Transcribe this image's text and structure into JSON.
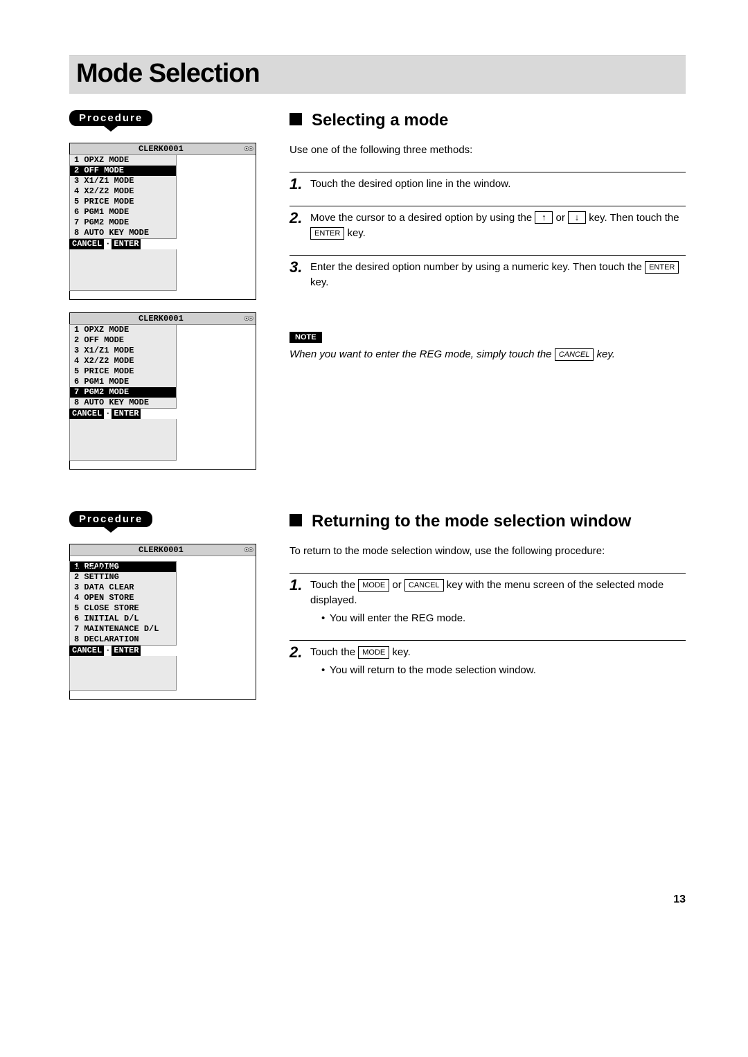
{
  "title": "Mode Selection",
  "procedure_label": "Procedure",
  "clerk": "CLERK0001",
  "header_glyphs": "☉☉",
  "screen1": {
    "items": [
      "1 OPXZ MODE",
      "2 OFF MODE",
      "3 X1/Z1 MODE",
      "4 X2/Z2 MODE",
      "5 PRICE MODE",
      "6 PGM1 MODE",
      "7 PGM2 MODE",
      "8 AUTO KEY MODE"
    ],
    "selected_index": 1
  },
  "screen2": {
    "items": [
      "1 OPXZ MODE",
      "2 OFF MODE",
      "3 X1/Z1 MODE",
      "4 X2/Z2 MODE",
      "5 PRICE MODE",
      "6 PGM1 MODE",
      "7 PGM2 MODE",
      "8 AUTO KEY MODE"
    ],
    "selected_index": 6
  },
  "screen3": {
    "panel_label": "PGM2 MODE",
    "items": [
      "1 READING",
      "2 SETTING",
      "3 DATA CLEAR",
      "4 OPEN STORE",
      "5 CLOSE STORE",
      "6 INITIAL D/L",
      "7 MAINTENANCE D/L",
      "8 DECLARATION"
    ],
    "selected_index": 0
  },
  "footer": {
    "cancel": "CANCEL",
    "enter": "ENTER"
  },
  "section1": {
    "heading": "Selecting a mode",
    "intro": "Use one of the following three methods:",
    "steps": {
      "s1": "Touch the desired option line in the window.",
      "s2a": "Move the cursor to a desired option by using the ",
      "s2b": " or ",
      "s2c": " key. Then touch the ",
      "s2d": " key.",
      "s3a": "Enter the desired option number by using a numeric key. Then touch the ",
      "s3b": " key."
    },
    "note_label": "NOTE",
    "note_a": "When you want to enter the REG mode, simply touch the ",
    "note_b": " key."
  },
  "section2": {
    "heading": "Returning to the mode selection window",
    "intro": "To return to the mode selection window, use the following procedure:",
    "steps": {
      "s1a": "Touch the ",
      "s1b": " or ",
      "s1c": " key with the menu screen of the selected mode displayed.",
      "s1_sub": "You will enter the REG mode.",
      "s2a": "Touch the ",
      "s2b": " key.",
      "s2_sub": "You will return to the mode selection window."
    }
  },
  "keys": {
    "enter": "ENTER",
    "cancel": "CANCEL",
    "mode": "MODE",
    "up": "↑",
    "down": "↓"
  },
  "page_number": "13"
}
